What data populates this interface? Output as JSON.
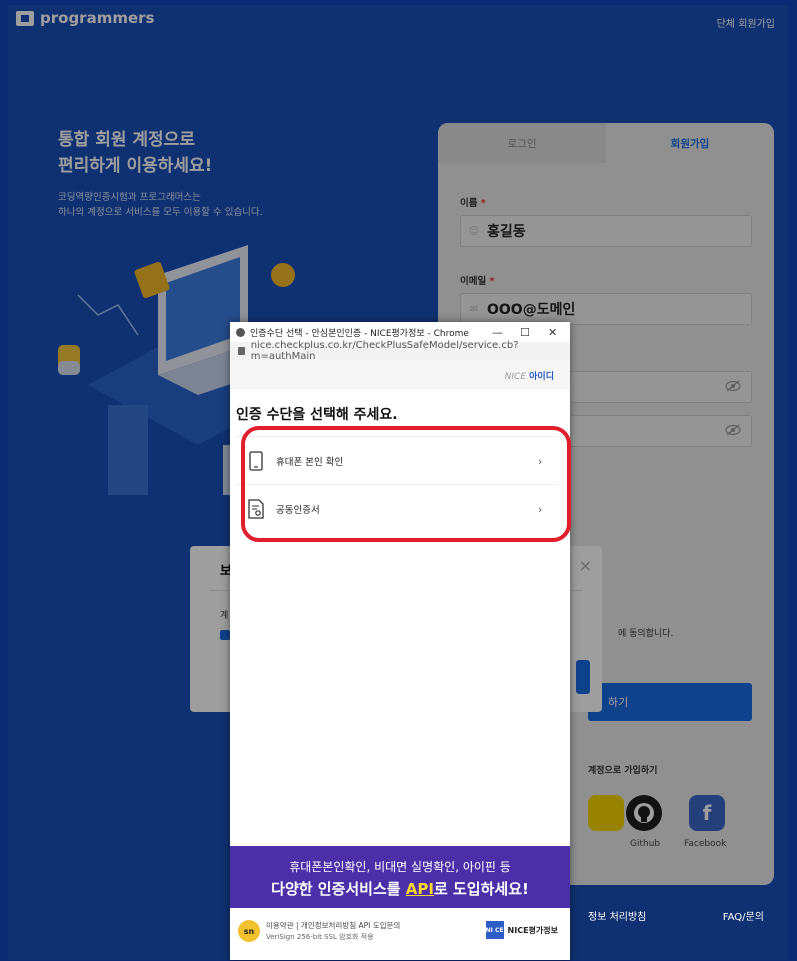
{
  "site": {
    "brand": "programmers",
    "org_signup": "단체 회원가입",
    "hero_title_line1": "통합 회원 계정으로",
    "hero_title_line2": "편리하게 이용하세요!",
    "hero_sub_line1": "코딩역량인증시험과 프로그래머스는",
    "hero_sub_line2": "하나의 계정으로 서비스를 모두 이용할 수 있습니다."
  },
  "card": {
    "tab_login": "로그인",
    "tab_signup": "회원가입",
    "name_label": "이름",
    "name_required": "*",
    "name_value": "홍길동",
    "email_label": "이메일",
    "email_required": "*",
    "email_value": "OOO@도메인",
    "agree_text": "에 동의합니다.",
    "join_button": "하기",
    "social_title": "계정으로 가입하기",
    "github_label": "Github",
    "facebook_label": "Facebook",
    "footer_privacy": "정보 처리방침",
    "footer_faq": "FAQ/문의"
  },
  "dim_modal": {
    "title": "보",
    "close": "×",
    "text": "계"
  },
  "popup": {
    "window_title": "인증수단 선택 - 안심본인인증 - NICE평가정보 - Chrome",
    "win_min": "—",
    "win_max": "☐",
    "win_close": "✕",
    "url": "nice.checkplus.co.kr/CheckPlusSafeModel/service.cb?m=authMain",
    "nice_logo_prefix": "NICE",
    "nice_logo": "아이디",
    "heading": "인증 수단을 선택해 주세요.",
    "options": [
      {
        "label": "휴대폰 본인 확인",
        "chevron": "›"
      },
      {
        "label": "공동인증서",
        "chevron": "›"
      }
    ],
    "banner_line1": "휴대폰본인확인, 비대면 실명확인, 아이핀 등",
    "banner_line2_pre": "다양한 인증서비스를 ",
    "banner_line2_api": "API",
    "banner_line2_post": "로 도입하세요!",
    "footer_badge": "sn",
    "footer_line1": "이용약관 | 개인정보처리방침 API 도입문의",
    "footer_line2": "VeriSign 256-bit SSL 암호화 적용",
    "footer_brand": "NICE평가정보",
    "footer_brand_mark": "NI CE"
  },
  "colors": {
    "site_blue": "#1b4fb7",
    "accent_blue": "#1b6ae0",
    "highlight_red": "#e11f2c",
    "banner_purple": "#4a2fa8"
  }
}
